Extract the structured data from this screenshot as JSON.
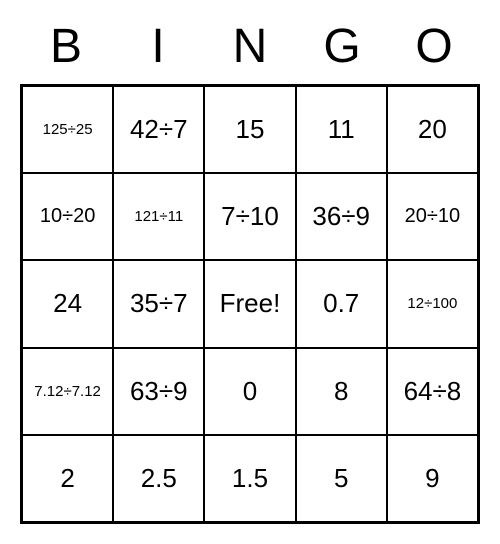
{
  "headers": [
    "B",
    "I",
    "N",
    "G",
    "O"
  ],
  "grid": [
    [
      {
        "text": "125÷25",
        "size": "small"
      },
      {
        "text": "42÷7",
        "size": "normal"
      },
      {
        "text": "15",
        "size": "normal"
      },
      {
        "text": "11",
        "size": "normal"
      },
      {
        "text": "20",
        "size": "normal"
      }
    ],
    [
      {
        "text": "10÷20",
        "size": "med"
      },
      {
        "text": "121÷11",
        "size": "small"
      },
      {
        "text": "7÷10",
        "size": "normal"
      },
      {
        "text": "36÷9",
        "size": "normal"
      },
      {
        "text": "20÷10",
        "size": "med"
      }
    ],
    [
      {
        "text": "24",
        "size": "normal"
      },
      {
        "text": "35÷7",
        "size": "normal"
      },
      {
        "text": "Free!",
        "size": "normal"
      },
      {
        "text": "0.7",
        "size": "normal"
      },
      {
        "text": "12÷100",
        "size": "small"
      }
    ],
    [
      {
        "text": "7.12÷7.12",
        "size": "small"
      },
      {
        "text": "63÷9",
        "size": "normal"
      },
      {
        "text": "0",
        "size": "normal"
      },
      {
        "text": "8",
        "size": "normal"
      },
      {
        "text": "64÷8",
        "size": "normal"
      }
    ],
    [
      {
        "text": "2",
        "size": "normal"
      },
      {
        "text": "2.5",
        "size": "normal"
      },
      {
        "text": "1.5",
        "size": "normal"
      },
      {
        "text": "5",
        "size": "normal"
      },
      {
        "text": "9",
        "size": "normal"
      }
    ]
  ]
}
